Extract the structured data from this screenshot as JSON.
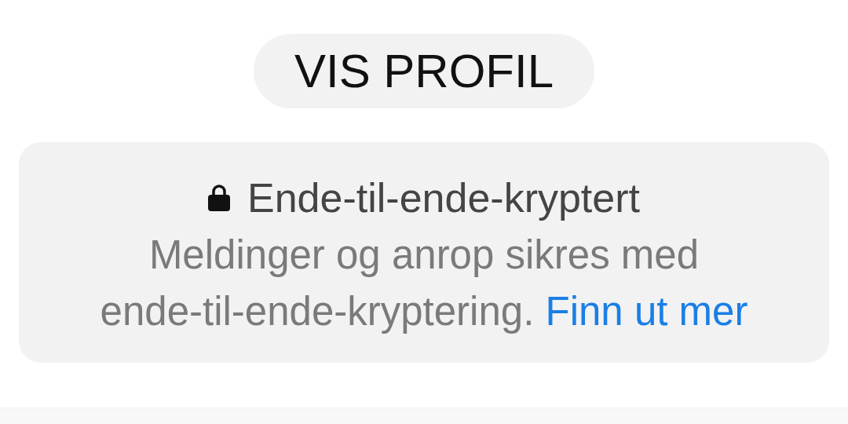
{
  "profile_button": {
    "label": "VIS PROFIL"
  },
  "encryption_notice": {
    "title": "Ende-til-ende-kryptert",
    "text_lines": [
      "Meldinger og anrop sikres med",
      "ende-til-ende-kryptering."
    ],
    "link": "Finn ut mer"
  }
}
